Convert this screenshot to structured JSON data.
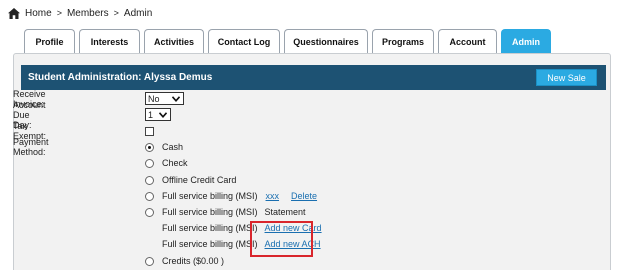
{
  "breadcrumb": {
    "home": "Home",
    "members": "Members",
    "current": "Admin",
    "separator": ">"
  },
  "tabs": [
    "Profile",
    "Interests",
    "Activities",
    "Contact Log",
    "Questionnaires",
    "Programs",
    "Account",
    "Admin"
  ],
  "active_tab": "Admin",
  "panel": {
    "title": "Student Administration: Alyssa Demus",
    "new_sale_label": "New Sale"
  },
  "fields": {
    "receive_invoice": {
      "label": "Receive Invoice:",
      "value": "No"
    },
    "account_due_day": {
      "label": "Account Due Day:",
      "value": "1"
    },
    "tax_exempt": {
      "label": "Tax Exempt:",
      "checked": false
    },
    "payment_method": {
      "label": "Payment Method:"
    }
  },
  "payment_options": {
    "cash": "Cash",
    "check": "Check",
    "offline_credit_card": "Offline Credit Card",
    "fsb1_label": "Full service billing (MSI)",
    "fsb1_link1": "xxx",
    "fsb1_link2": "Delete",
    "fsb2_label": "Full service billing (MSI)",
    "fsb2_text": "Statement",
    "fsb3_label": "Full service billing (MSI)",
    "fsb3_link": "Add new Card",
    "fsb4_label": "Full service billing (MSI)",
    "fsb4_link": "Add new ACH",
    "credits": "Credits ($0.00 )"
  },
  "colors": {
    "accent": "#2baae2",
    "header": "#1d5273",
    "highlight": "#d9262c",
    "link": "#1a6fb0"
  }
}
